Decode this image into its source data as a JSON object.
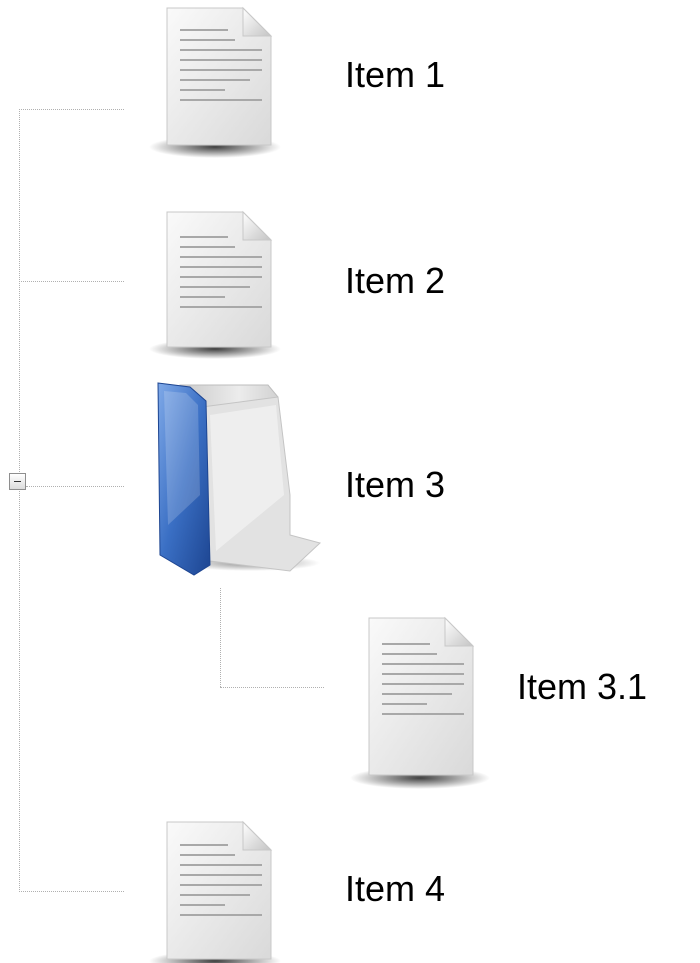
{
  "tree": {
    "toggle": {
      "state": "expanded",
      "symbol": "−"
    },
    "items": [
      {
        "label": "Item 1",
        "icon": "document-icon"
      },
      {
        "label": "Item 2",
        "icon": "document-icon"
      },
      {
        "label": "Item 3",
        "icon": "folder-icon",
        "expanded": true,
        "children": [
          {
            "label": "Item 3.1",
            "icon": "document-icon"
          }
        ]
      },
      {
        "label": "Item 4",
        "icon": "document-icon"
      }
    ]
  },
  "colors": {
    "connector": "#b0b0b0",
    "folder_blue": "#3a6fc4",
    "paper": "#eeeeee"
  }
}
